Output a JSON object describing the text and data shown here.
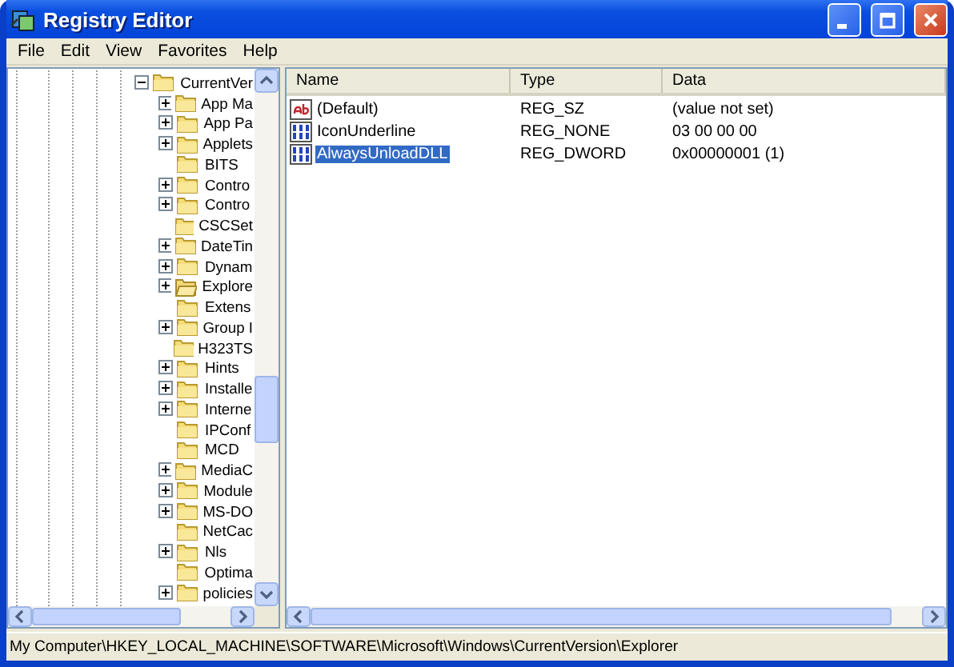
{
  "window": {
    "title": "Registry Editor"
  },
  "menu": [
    "File",
    "Edit",
    "View",
    "Favorites",
    "Help"
  ],
  "tree": {
    "items": [
      {
        "label": "CurrentVer",
        "expanded": true,
        "current": false,
        "children": [
          {
            "label": "App Ma",
            "has_children": true,
            "expanded": false,
            "current": false
          },
          {
            "label": "App Pa",
            "has_children": true,
            "expanded": false,
            "current": false
          },
          {
            "label": "Applets",
            "has_children": true,
            "expanded": false,
            "current": false
          },
          {
            "label": "BITS",
            "has_children": false,
            "expanded": false,
            "current": false
          },
          {
            "label": "Contro",
            "has_children": true,
            "expanded": false,
            "current": false
          },
          {
            "label": "Contro",
            "has_children": true,
            "expanded": false,
            "current": false
          },
          {
            "label": "CSCSet",
            "has_children": false,
            "expanded": false,
            "current": false
          },
          {
            "label": "DateTin",
            "has_children": true,
            "expanded": false,
            "current": false
          },
          {
            "label": "Dynam",
            "has_children": true,
            "expanded": false,
            "current": false
          },
          {
            "label": "Explore",
            "has_children": true,
            "expanded": false,
            "current": true
          },
          {
            "label": "Extens",
            "has_children": false,
            "expanded": false,
            "current": false
          },
          {
            "label": "Group I",
            "has_children": true,
            "expanded": false,
            "current": false
          },
          {
            "label": "H323TS",
            "has_children": false,
            "expanded": false,
            "current": false
          },
          {
            "label": "Hints",
            "has_children": true,
            "expanded": false,
            "current": false
          },
          {
            "label": "Installe",
            "has_children": true,
            "expanded": false,
            "current": false
          },
          {
            "label": "Interne",
            "has_children": true,
            "expanded": false,
            "current": false
          },
          {
            "label": "IPConf",
            "has_children": false,
            "expanded": false,
            "current": false
          },
          {
            "label": "MCD",
            "has_children": false,
            "expanded": false,
            "current": false
          },
          {
            "label": "MediaC",
            "has_children": true,
            "expanded": false,
            "current": false
          },
          {
            "label": "Module",
            "has_children": true,
            "expanded": false,
            "current": false
          },
          {
            "label": "MS-DO",
            "has_children": true,
            "expanded": false,
            "current": false
          },
          {
            "label": "NetCac",
            "has_children": false,
            "expanded": false,
            "current": false
          },
          {
            "label": "Nls",
            "has_children": true,
            "expanded": false,
            "current": false
          },
          {
            "label": "Optima",
            "has_children": false,
            "expanded": false,
            "current": false
          },
          {
            "label": "policies",
            "has_children": true,
            "expanded": false,
            "current": false
          }
        ]
      }
    ]
  },
  "values": {
    "columns": [
      "Name",
      "Type",
      "Data"
    ],
    "rows": [
      {
        "kind": "string",
        "name": "(Default)",
        "type": "REG_SZ",
        "data": "(value not set)",
        "selected": false
      },
      {
        "kind": "binary",
        "name": "IconUnderline",
        "type": "REG_NONE",
        "data": "03 00 00 00",
        "selected": false
      },
      {
        "kind": "binary",
        "name": "AlwaysUnloadDLL",
        "type": "REG_DWORD",
        "data": "0x00000001 (1)",
        "selected": true
      }
    ]
  },
  "status_bar": "My Computer\\HKEY_LOCAL_MACHINE\\SOFTWARE\\Microsoft\\Windows\\CurrentVersion\\Explorer"
}
